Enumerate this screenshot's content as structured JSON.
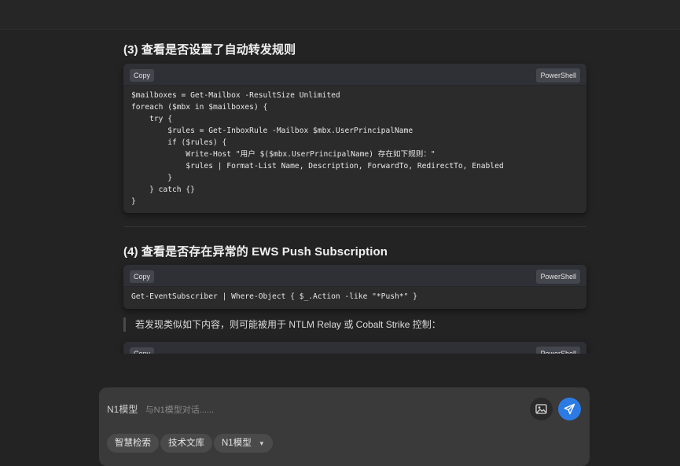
{
  "sections": {
    "s3": {
      "title": "(3) 查看是否设置了自动转发规则",
      "copy_label": "Copy",
      "lang": "PowerShell",
      "code": "$mailboxes = Get-Mailbox -ResultSize Unlimited\nforeach ($mbx in $mailboxes) {\n    try {\n        $rules = Get-InboxRule -Mailbox $mbx.UserPrincipalName\n        if ($rules) {\n            Write-Host \"用户 $($mbx.UserPrincipalName) 存在如下规则：\"\n            $rules | Format-List Name, Description, ForwardTo, RedirectTo, Enabled\n        }\n    } catch {}\n}"
    },
    "s4": {
      "title": "(4) 查看是否存在异常的 EWS Push Subscription",
      "copy_label": "Copy",
      "lang": "PowerShell",
      "code": "Get-EventSubscriber | Where-Object { $_.Action -like \"*Push*\" }"
    },
    "quote": "若发现类似如下内容，则可能被用于 NTLM Relay 或 Cobalt Strike 控制：",
    "partial_block": {
      "copy_label": "Copy",
      "lang": "PowerShell"
    }
  },
  "composer": {
    "model_label": "N1模型",
    "placeholder": "与N1模型对话......",
    "chips": {
      "smart_search": "智慧检索",
      "tech_library": "技术文库",
      "model_select": "N1模型"
    }
  },
  "colors": {
    "background": "#232323",
    "code_bg": "#2b2b2b",
    "send_button": "#2c7be5",
    "composer_bg": "#3a3a3a"
  },
  "icons": {
    "image": "image-icon",
    "send": "send-icon",
    "dropdown": "chevron-down-icon"
  }
}
